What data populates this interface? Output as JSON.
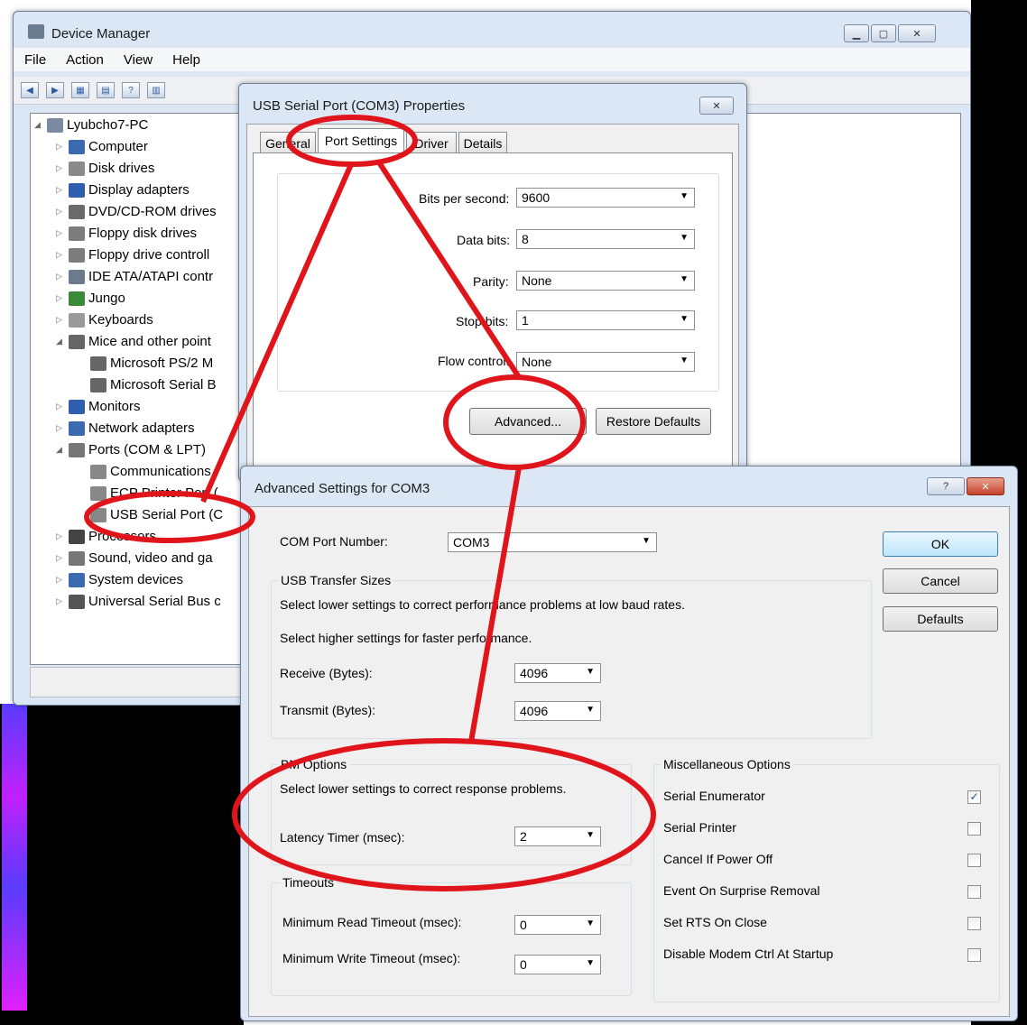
{
  "device_manager": {
    "title": "Device Manager",
    "menu": [
      "File",
      "Action",
      "View",
      "Help"
    ],
    "tree": {
      "root": "Lyubcho7-PC",
      "items": [
        "Computer",
        "Disk drives",
        "Display adapters",
        "DVD/CD-ROM drives",
        "Floppy disk drives",
        "Floppy drive controll",
        "IDE ATA/ATAPI contr",
        "Jungo",
        "Keyboards",
        "Mice and other point",
        "Microsoft PS/2 M",
        "Microsoft Serial B",
        "Monitors",
        "Network adapters",
        "Ports (COM & LPT)",
        "Communications",
        "ECP Printer Port (",
        "USB Serial Port (C",
        "Processors",
        "Sound, video and ga",
        "System devices",
        "Universal Serial Bus c"
      ]
    }
  },
  "properties": {
    "title": "USB Serial Port (COM3) Properties",
    "tabs": [
      "General",
      "Port Settings",
      "Driver",
      "Details"
    ],
    "fields": [
      {
        "label": "Bits per second:",
        "value": "9600"
      },
      {
        "label": "Data bits:",
        "value": "8"
      },
      {
        "label": "Parity:",
        "value": "None"
      },
      {
        "label": "Stop bits:",
        "value": "1"
      },
      {
        "label": "Flow control:",
        "value": "None"
      }
    ],
    "advanced_button": "Advanced...",
    "restore_button": "Restore Defaults"
  },
  "advanced": {
    "title": "Advanced Settings for COM3",
    "help_btn": "?",
    "close_btn": "✕",
    "com_port_label": "COM Port Number:",
    "com_port_value": "COM3",
    "ok": "OK",
    "cancel": "Cancel",
    "defaults": "Defaults",
    "usb": {
      "title": "USB Transfer Sizes",
      "line1": "Select lower settings to correct performance problems at low baud rates.",
      "line2": "Select higher settings for faster performance.",
      "receive_label": "Receive (Bytes):",
      "receive_value": "4096",
      "transmit_label": "Transmit (Bytes):",
      "transmit_value": "4096"
    },
    "bm": {
      "title": "BM Options",
      "line": "Select lower settings to correct response problems.",
      "latency_label": "Latency Timer (msec):",
      "latency_value": "2"
    },
    "timeouts": {
      "title": "Timeouts",
      "read_label": "Minimum Read Timeout (msec):",
      "read_value": "0",
      "write_label": "Minimum Write Timeout (msec):",
      "write_value": "0"
    },
    "misc": {
      "title": "Miscellaneous Options",
      "options": [
        {
          "label": "Serial Enumerator",
          "checked": true
        },
        {
          "label": "Serial Printer",
          "checked": false
        },
        {
          "label": "Cancel If Power Off",
          "checked": false
        },
        {
          "label": "Event On Surprise Removal",
          "checked": false
        },
        {
          "label": "Set RTS On Close",
          "checked": false
        },
        {
          "label": "Disable Modem Ctrl At Startup",
          "checked": false
        }
      ]
    }
  },
  "colors": {
    "annotation": "#e0141b",
    "accent": "#3c7fb1"
  }
}
